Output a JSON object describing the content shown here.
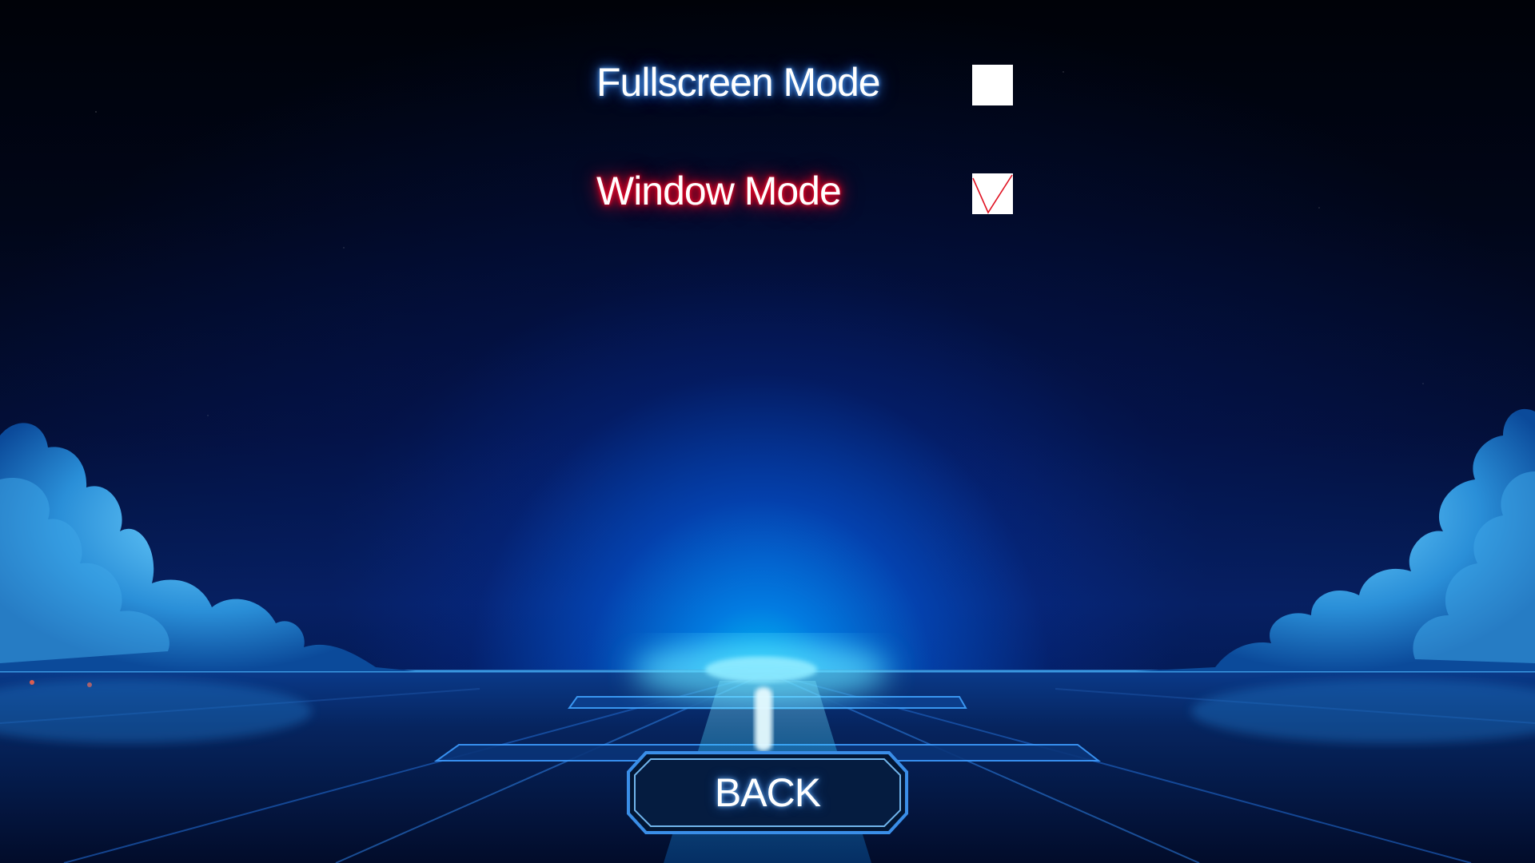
{
  "settings": {
    "fullscreen": {
      "label": "Fullscreen Mode",
      "checked": false,
      "selected": false
    },
    "window": {
      "label": "Window Mode",
      "checked": true,
      "selected": true
    }
  },
  "back_button": {
    "label": "BACK"
  },
  "colors": {
    "selected_glow": "#ff0020",
    "default_glow": "#3c8cff",
    "check_mark": "#e01020",
    "button_fill": "#071a3a",
    "button_border": "#4aa8ff"
  }
}
